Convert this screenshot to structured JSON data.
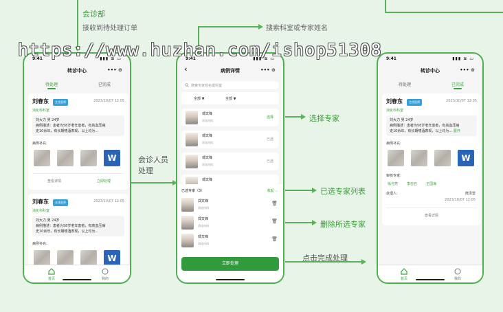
{
  "watermark": "https://www.huzhan.com/ishop51308",
  "annotations": {
    "consult_dept": "会诊部",
    "receive_order": "接收到待处理订单",
    "search_hint": "搜索科室或专家姓名",
    "choose_expert": "选择专家",
    "consult_staff_l1": "会诊人员",
    "consult_staff_l2": "处理",
    "selected_list": "已选专家列表",
    "delete_selected": "删除所选专家",
    "click_complete": "点击完成处理"
  },
  "phone1": {
    "time": "9:41",
    "signal": "▮▮▮ ≋ ▭",
    "title": "转诊中心",
    "capsule": "•••  ⊙",
    "tabs": [
      "待处理",
      "已完成"
    ],
    "cards": [
      {
        "name": "刘春东",
        "badge": "主任医师",
        "date": "2023/10/07 12:05",
        "dept": "消化科科室",
        "desc_line1": "刘大力 男 24岁",
        "desc_line2": "病例描述：患者为58岁老年患者，有高血压病",
        "desc_line3": "史10余年，有长期嗜酒表现，以上均为...",
        "supp_label": "病例补充:",
        "detail_btn": "查看详情",
        "process_btn": "立即处理"
      },
      {
        "name": "刘春东",
        "badge": "主任医师",
        "date": "2023/10/07 12:05",
        "dept": "消化科科室",
        "desc_line1": "刘大力 男 24岁",
        "desc_line2": "病例描述：患者为58岁老年患者，有高血压病",
        "desc_line3": "史10余年，有长期嗜酒表现，以上均为...",
        "supp_label": "病例补充:"
      }
    ],
    "word_icon": "W",
    "nav": [
      "首页",
      "我的"
    ]
  },
  "phone2": {
    "time": "9:41",
    "signal": "▮▮▮ ≋ ▭",
    "back": "‹",
    "title": "病例详情",
    "capsule": "•••  ⊙",
    "search_placeholder": "搜索专家姓名或科室",
    "filters": [
      "全部 ▼",
      "全部 ▼"
    ],
    "experts": [
      {
        "name": "郑文锋",
        "dept": "消化内科",
        "action": "选择"
      },
      {
        "name": "郑文锋",
        "dept": "消化内科",
        "action": "已选"
      },
      {
        "name": "郑文锋",
        "dept": "消化内科",
        "action": "已选"
      },
      {
        "name": "郑文锋",
        "dept": "",
        "action": ""
      }
    ],
    "selected_title": "已选专家（3）",
    "selected_toggle": "收起 ⌵",
    "selected": [
      {
        "name": "郑文锋",
        "dept": "消化内科"
      },
      {
        "name": "郑文锋",
        "dept": "消化内科"
      },
      {
        "name": "郑文锋",
        "dept": "消化内科"
      }
    ],
    "trash_icon": "🗑",
    "submit": "立即处理"
  },
  "phone3": {
    "time": "9:41",
    "signal": "▮▮▮ ≋ ▭",
    "title": "转诊中心",
    "capsule": "•••  ⊙",
    "tabs": [
      "待处理",
      "已完成"
    ],
    "card": {
      "name": "刘春东",
      "badge": "主任医师",
      "date": "2023/10/07 12:05",
      "dept": "消化科科室",
      "desc_line1": "刘大力 男 24岁",
      "desc_line2": "病例描述：患者为58岁老年患者，有高血压病",
      "desc_line3": "史10余年，有长期嗜酒表现，以上均为...",
      "expand": "展开",
      "supp_label": "病例补充:",
      "reviewer_label": "审核专家:",
      "reviewers": [
        "徐光亮",
        "李召召",
        "王国海"
      ],
      "handler_label": "处理人:",
      "handler": "熊泽雷",
      "handled_date": "2023/10/07 12:05",
      "detail_btn": "查看详情"
    },
    "word_icon": "W",
    "nav": [
      "首页",
      "我的"
    ]
  }
}
